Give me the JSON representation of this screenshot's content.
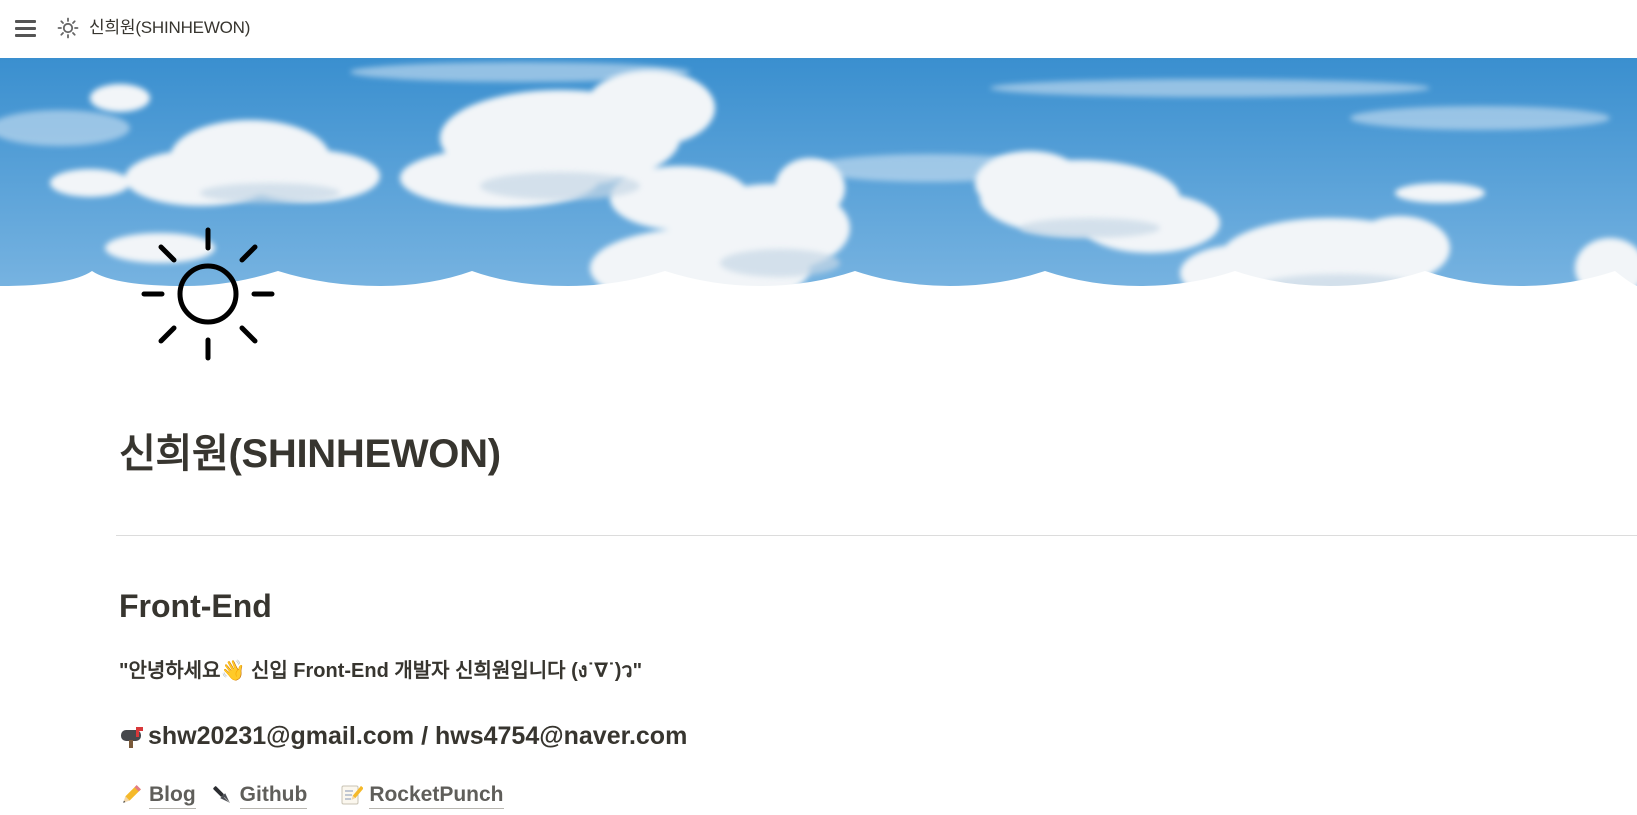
{
  "topbar": {
    "menu_icon": "hamburger-menu-icon",
    "page_icon": "sun-icon",
    "breadcrumb_title": "신희원(SHINHEWON)"
  },
  "cover": {
    "image": "blue-sky-clouds",
    "sky_top_color": "#3a8fcf",
    "sky_bottom_color": "#7cb6e2",
    "cloud_color": "#f2f5f8"
  },
  "page": {
    "icon": "sun-icon",
    "title": "신희원(SHINHEWON)",
    "section_heading": "Front-End",
    "greeting": "\"안녕하세요👋 신입 Front-End 개발자 신희원입니다 (ง˙∇˙)ว\"",
    "contact": {
      "icon": "mailbox-icon",
      "text": "shw20231@gmail.com / hws4754@naver.com"
    },
    "links": [
      {
        "icon": "pencil-icon",
        "label": "Blog"
      },
      {
        "icon": "black-nib-icon",
        "label": "Github"
      },
      {
        "icon": "memo-icon",
        "label": "RocketPunch"
      }
    ]
  }
}
